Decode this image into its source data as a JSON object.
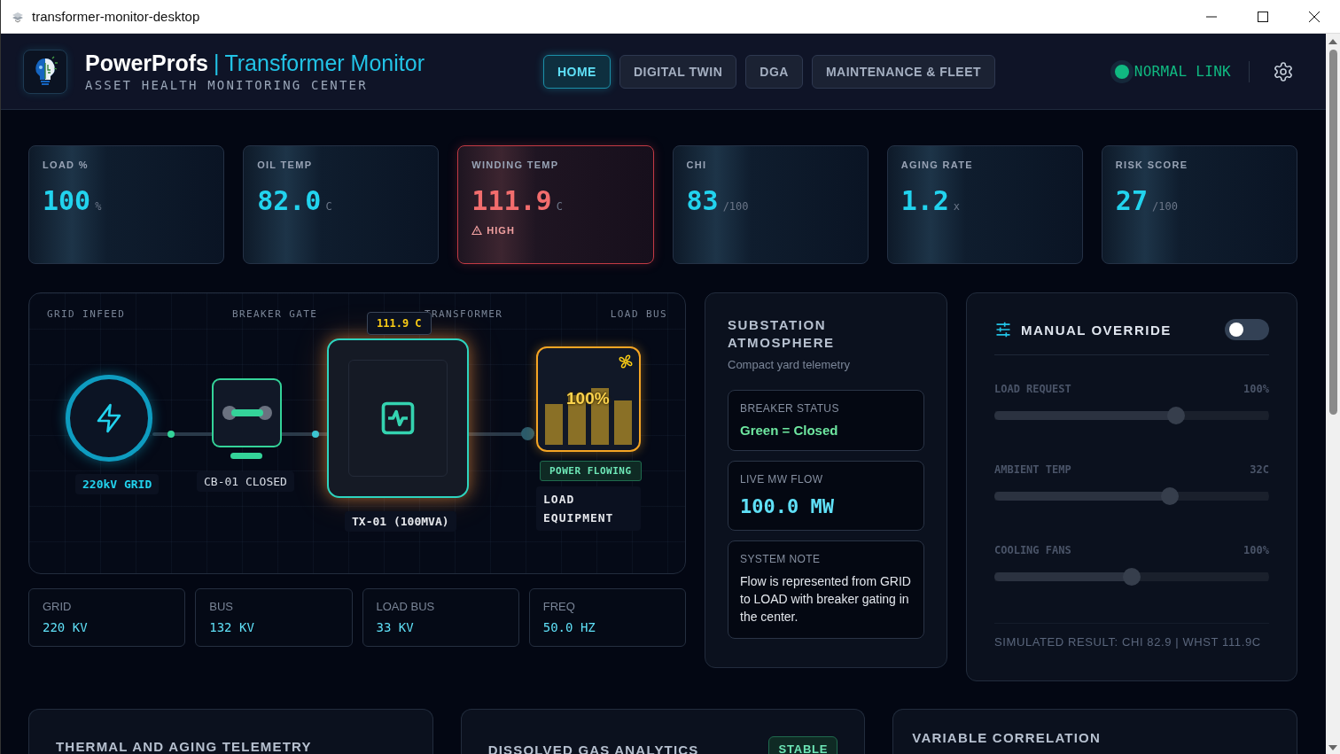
{
  "window": {
    "title": "transformer-monitor-desktop"
  },
  "header": {
    "brand": "PowerProfs",
    "separator": "|",
    "product": "Transformer Monitor",
    "subtitle": "ASSET HEALTH MONITORING CENTER",
    "tabs": [
      {
        "label": "HOME",
        "selected": true
      },
      {
        "label": "DIGITAL TWIN",
        "selected": false
      },
      {
        "label": "DGA",
        "selected": false
      },
      {
        "label": "MAINTENANCE & FLEET",
        "selected": false
      }
    ],
    "link": {
      "label": "NORMAL LINK",
      "color": "#10b981"
    }
  },
  "metrics": [
    {
      "label": "LOAD %",
      "value": "100",
      "unit": "%",
      "kind": "normal"
    },
    {
      "label": "OIL TEMP",
      "value": "82.0",
      "unit": "C",
      "kind": "normal"
    },
    {
      "label": "WINDING TEMP",
      "value": "111.9",
      "unit": "C",
      "kind": "alert",
      "alert": "HIGH"
    },
    {
      "label": "CHI",
      "value": "83",
      "unit": "/100",
      "kind": "normal"
    },
    {
      "label": "AGING RATE",
      "value": "1.2",
      "unit": "x",
      "kind": "normal"
    },
    {
      "label": "RISK SCORE",
      "value": "27",
      "unit": "/100",
      "kind": "normal"
    }
  ],
  "flow": {
    "stages": [
      "GRID INFEED",
      "BREAKER GATE",
      "TRANSFORMER",
      "LOAD BUS"
    ],
    "nodes": [
      {
        "kind": "grid",
        "label": "220kV GRID"
      },
      {
        "kind": "breaker",
        "label": "CB-01 CLOSED",
        "closed": true
      },
      {
        "kind": "transformer",
        "label": "TX-01 (100MVA)",
        "badge": "111.9 C"
      },
      {
        "kind": "load",
        "label": "LOAD EQUIPMENT",
        "overlay": "100%",
        "status": "POWER FLOWING"
      }
    ]
  },
  "bus_readings": [
    {
      "label": "GRID",
      "value": "220 KV"
    },
    {
      "label": "BUS",
      "value": "132 KV"
    },
    {
      "label": "LOAD BUS",
      "value": "33 KV"
    },
    {
      "label": "FREQ",
      "value": "50.0 HZ"
    }
  ],
  "atmosphere": {
    "title": "SUBSTATION ATMOSPHERE",
    "subtitle": "Compact yard telemetry",
    "cards": [
      {
        "kind": "status",
        "label": "BREAKER STATUS",
        "value": "Green = Closed"
      },
      {
        "kind": "metric",
        "label": "LIVE MW FLOW",
        "value": "100.0 MW"
      },
      {
        "kind": "note",
        "label": "SYSTEM NOTE",
        "value": "Flow is represented from GRID to LOAD with breaker gating in the center."
      }
    ]
  },
  "override": {
    "title": "MANUAL OVERRIDE",
    "on": false,
    "sliders": [
      {
        "label": "LOAD REQUEST",
        "reading": "100%",
        "level": 0.66
      },
      {
        "label": "AMBIENT TEMP",
        "reading": "32C",
        "level": 0.64
      },
      {
        "label": "COOLING FANS",
        "reading": "100%",
        "level": 0.5
      }
    ],
    "result": "SIMULATED RESULT: CHI 82.9 | WHST 111.9C"
  },
  "panels": [
    {
      "title": "THERMAL AND AGING TELEMETRY"
    },
    {
      "title": "DISSOLVED GAS ANALYTICS",
      "badge": "STABLE"
    },
    {
      "title": "VARIABLE CORRELATION"
    }
  ]
}
